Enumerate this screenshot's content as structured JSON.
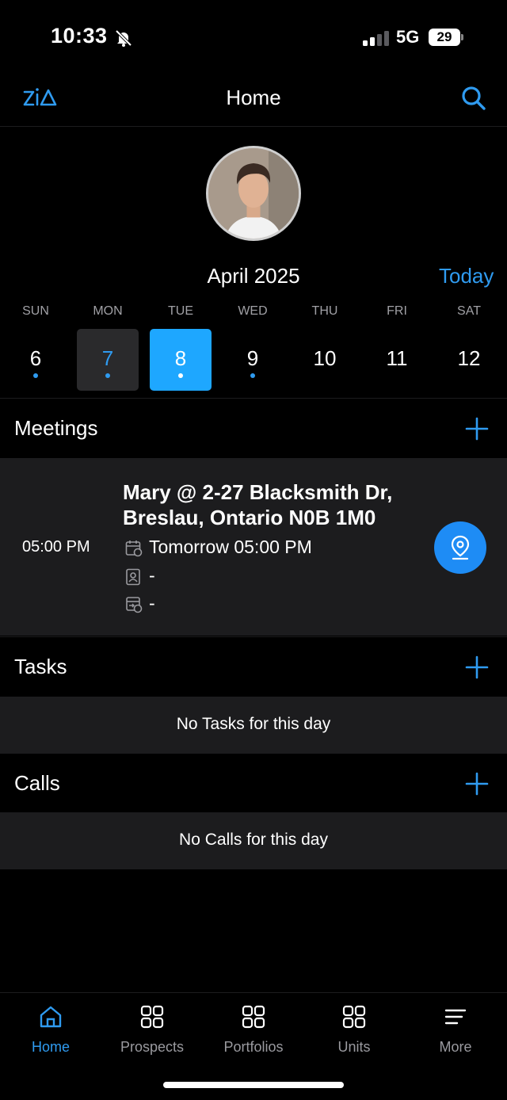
{
  "status": {
    "time": "10:33",
    "network": "5G",
    "battery": "29"
  },
  "nav": {
    "title": "Home"
  },
  "calendar": {
    "month": "April 2025",
    "today_label": "Today",
    "days": [
      {
        "name": "SUN",
        "num": "6"
      },
      {
        "name": "MON",
        "num": "7"
      },
      {
        "name": "TUE",
        "num": "8"
      },
      {
        "name": "WED",
        "num": "9"
      },
      {
        "name": "THU",
        "num": "10"
      },
      {
        "name": "FRI",
        "num": "11"
      },
      {
        "name": "SAT",
        "num": "12"
      }
    ]
  },
  "meetings": {
    "title": "Meetings",
    "items": [
      {
        "time": "05:00 PM",
        "title": "Mary @ 2-27 Blacksmith Dr, Breslau, Ontario N0B 1M0",
        "when": "Tomorrow  05:00 PM",
        "contact": "-",
        "related": "-"
      }
    ]
  },
  "tasks": {
    "title": "Tasks",
    "empty": "No Tasks for this day"
  },
  "calls": {
    "title": "Calls",
    "empty": "No Calls for this day"
  },
  "tabs": [
    {
      "label": "Home",
      "icon": "home-icon"
    },
    {
      "label": "Prospects",
      "icon": "grid-icon"
    },
    {
      "label": "Portfolios",
      "icon": "grid-icon"
    },
    {
      "label": "Units",
      "icon": "grid-icon"
    },
    {
      "label": "More",
      "icon": "menu-icon"
    }
  ],
  "colors": {
    "accent": "#2f9bf0",
    "selected_day": "#1ea7ff",
    "card": "#1c1c1e"
  }
}
